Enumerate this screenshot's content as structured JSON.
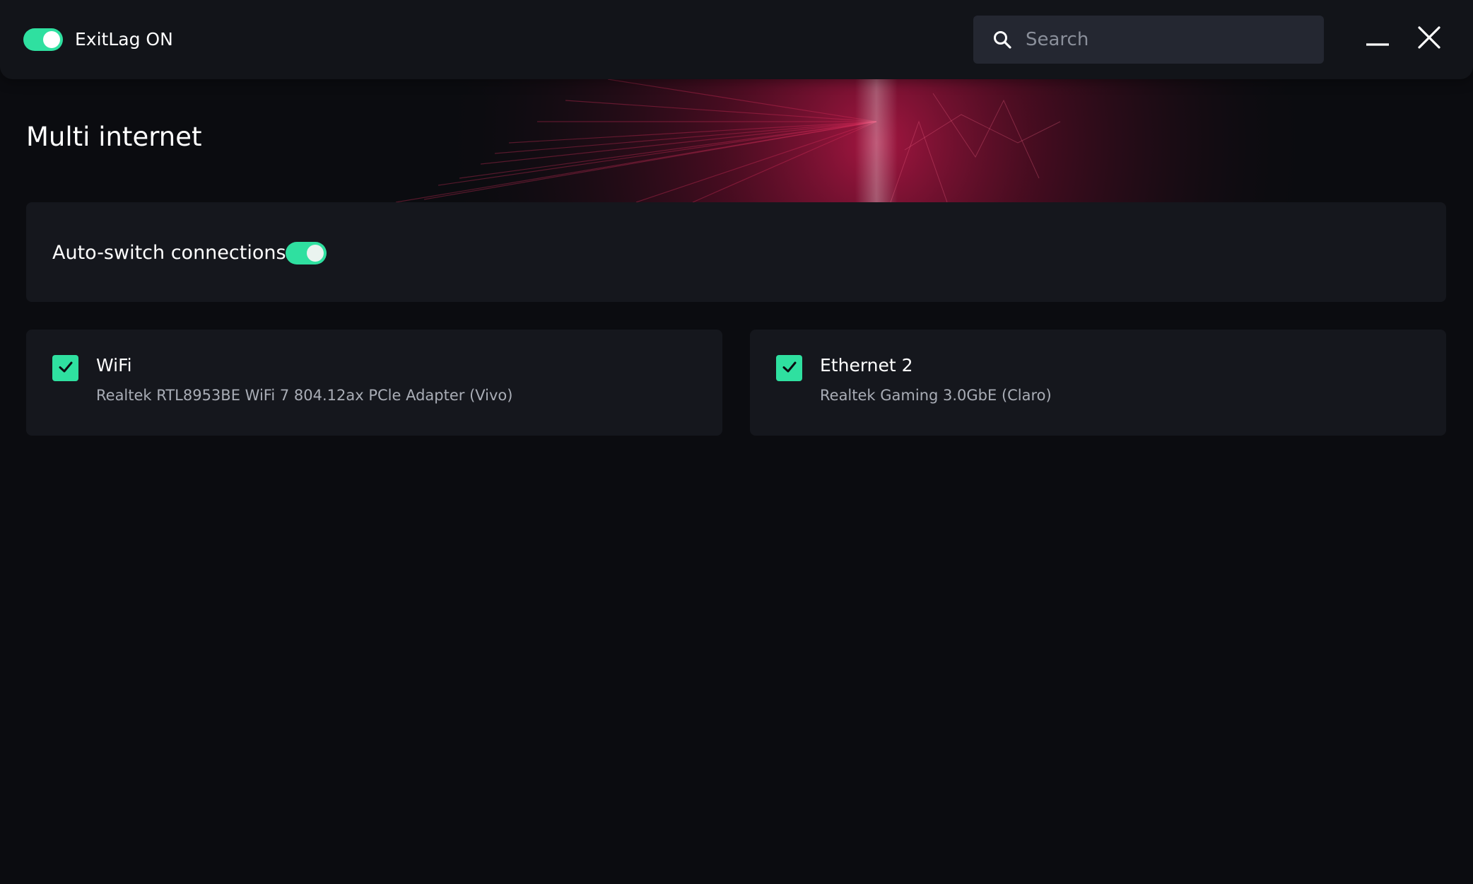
{
  "titlebar": {
    "app_status": "ExitLag ON",
    "master_toggle_on": true,
    "search": {
      "placeholder": "Search",
      "value": ""
    }
  },
  "page": {
    "title": "Multi internet"
  },
  "auto_switch": {
    "label": "Auto-switch connections",
    "enabled": true
  },
  "connections": [
    {
      "name": "WiFi",
      "adapter": "Realtek RTL8953BE WiFi 7 804.12ax PCle Adapter (Vivo)",
      "checked": true
    },
    {
      "name": "Ethernet 2",
      "adapter": "Realtek Gaming 3.0GbE (Claro)",
      "checked": true
    }
  ],
  "colors": {
    "accent": "#2fe0a0",
    "background": "#0b0c10",
    "card": "#15171d",
    "titlebar": "#121419",
    "hero_accent": "#a0133c"
  },
  "icons": [
    "search-icon",
    "minimize-icon",
    "close-icon",
    "checkmark-icon"
  ]
}
